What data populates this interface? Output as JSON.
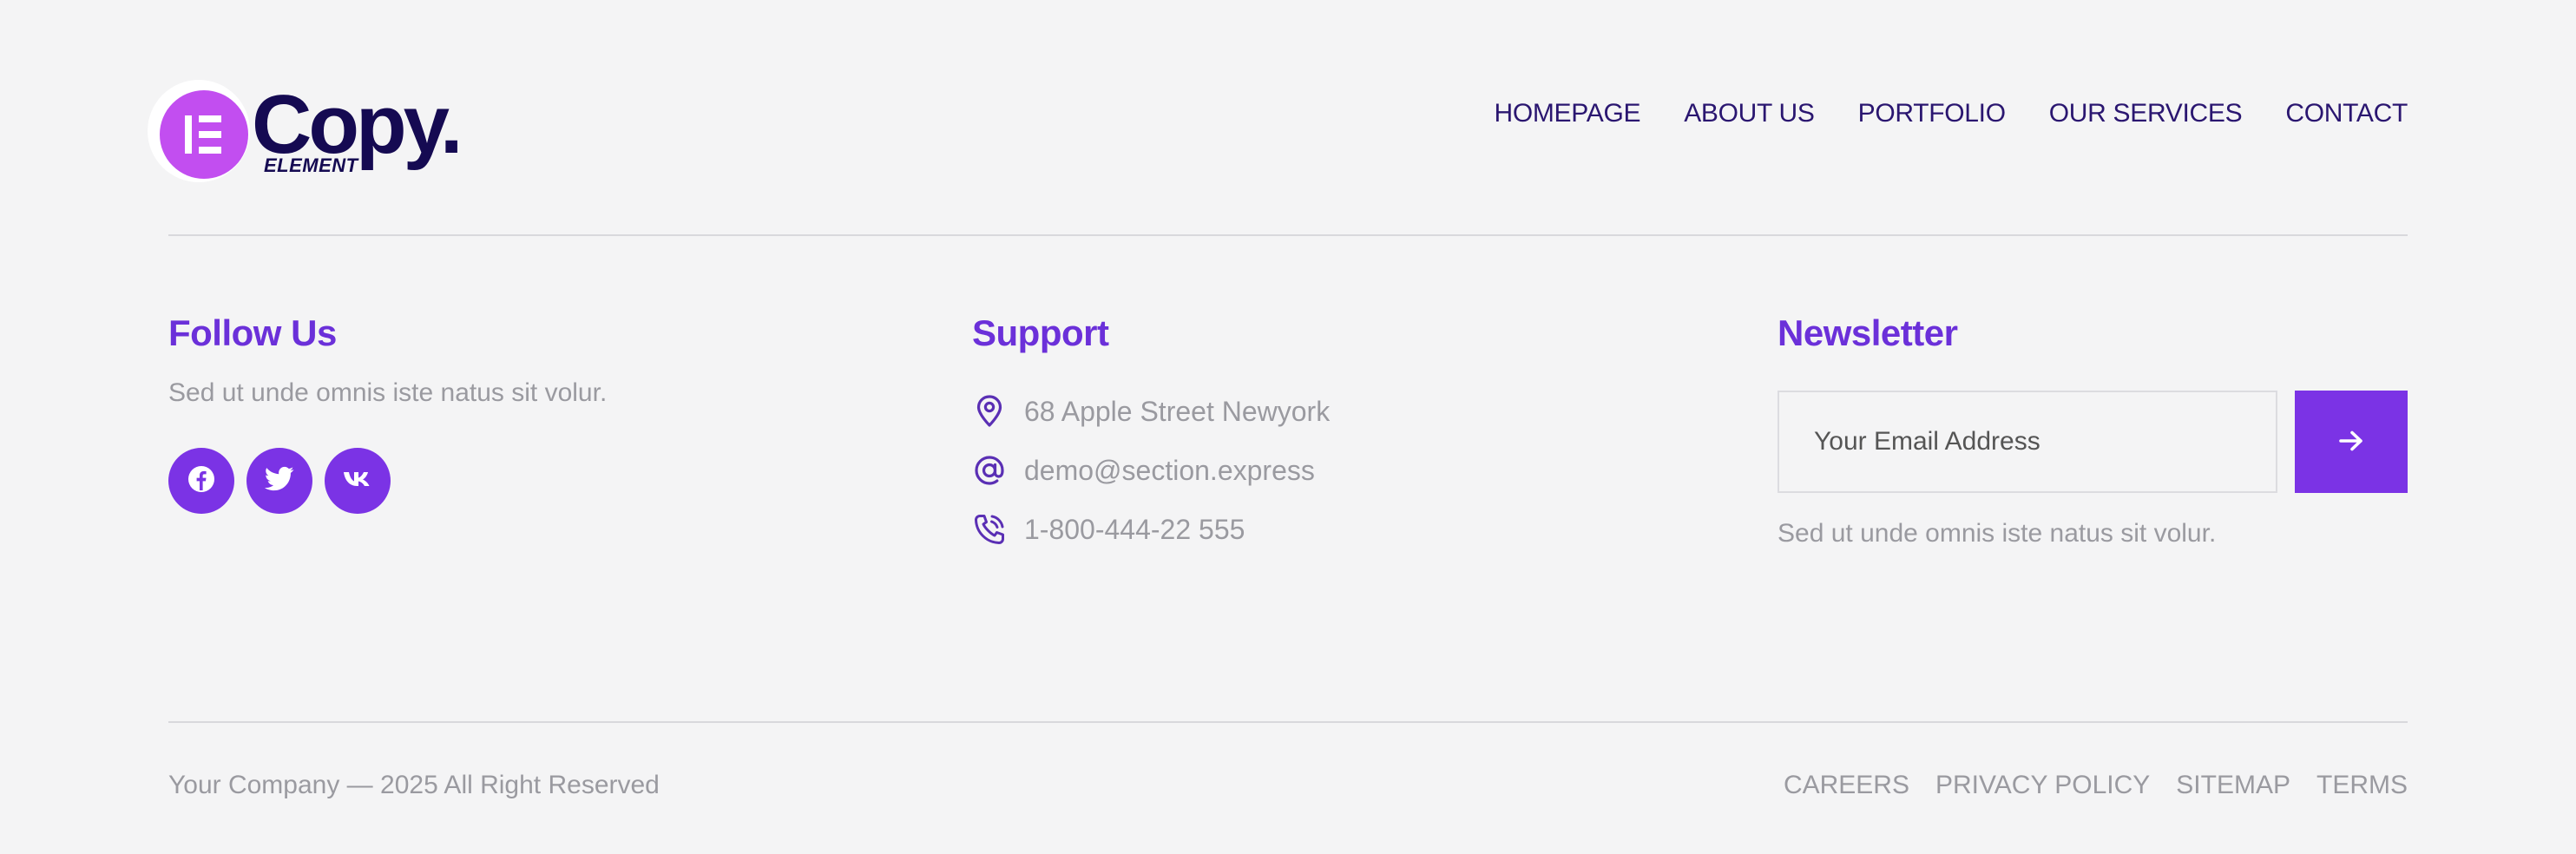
{
  "brand": {
    "name": "Copy.",
    "subtitle": "ELEMENT",
    "badge_letter": "E",
    "colors": {
      "dark": "#150a52",
      "badge": "#c24ef0",
      "accent": "#7b33e5",
      "heading": "#6b30d9"
    }
  },
  "nav": {
    "items": [
      {
        "label": "HOMEPAGE"
      },
      {
        "label": "ABOUT US"
      },
      {
        "label": "PORTFOLIO"
      },
      {
        "label": "OUR SERVICES"
      },
      {
        "label": "CONTACT"
      }
    ]
  },
  "follow": {
    "title": "Follow Us",
    "text": "Sed ut unde omnis iste natus sit volur.",
    "socials": [
      {
        "icon": "facebook-icon"
      },
      {
        "icon": "twitter-icon"
      },
      {
        "icon": "vk-icon"
      }
    ]
  },
  "support": {
    "title": "Support",
    "items": [
      {
        "icon": "location-pin-icon",
        "text": "68 Apple Street Newyork"
      },
      {
        "icon": "at-sign-icon",
        "text": "demo@section.express"
      },
      {
        "icon": "phone-icon",
        "text": "1-800-444-22 555"
      }
    ]
  },
  "newsletter": {
    "title": "Newsletter",
    "placeholder": "Your Email Address",
    "submit_icon": "arrow-right-icon",
    "text": "Sed ut unde omnis iste natus sit volur."
  },
  "footer": {
    "copyright": "Your Company — 2025 All Right Reserved",
    "links": [
      {
        "label": "CAREERS"
      },
      {
        "label": "PRIVACY POLICY"
      },
      {
        "label": "SITEMAP"
      },
      {
        "label": "TERMS"
      }
    ]
  }
}
